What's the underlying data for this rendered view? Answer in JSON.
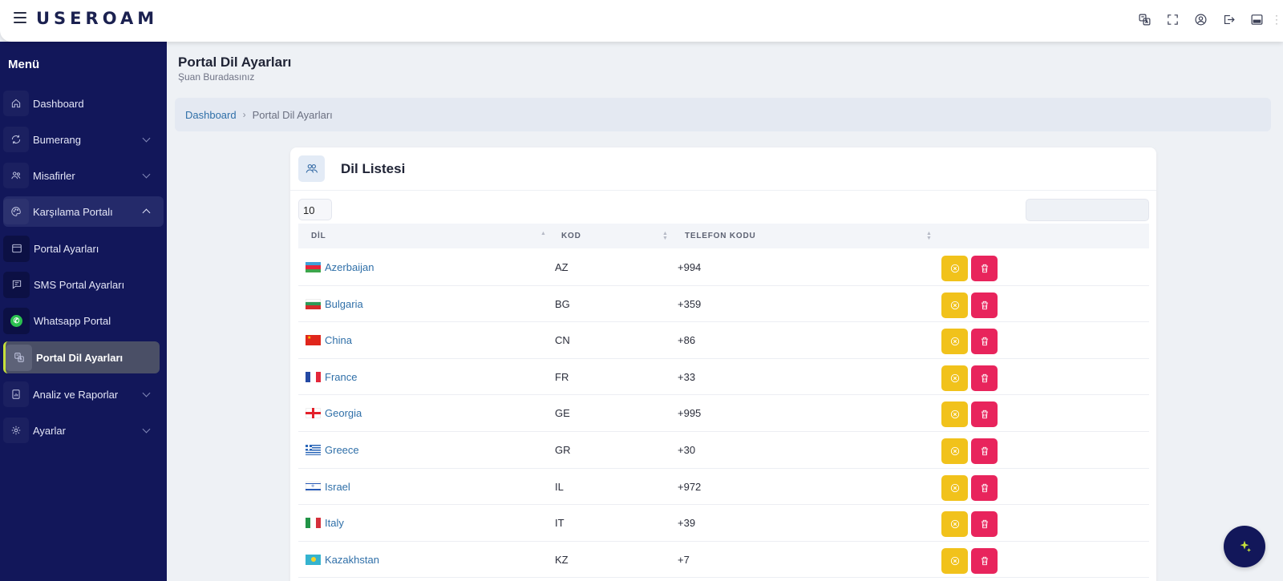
{
  "header": {
    "logo": "USEROAM",
    "icons": [
      "translate-icon",
      "fullscreen-icon",
      "user-icon",
      "logout-icon",
      "panel-icon"
    ]
  },
  "sidebar": {
    "title": "Menü",
    "items": [
      {
        "label": "Dashboard",
        "icon": "home-icon"
      },
      {
        "label": "Bumerang",
        "icon": "refresh-icon"
      },
      {
        "label": "Misafirler",
        "icon": "users-icon"
      },
      {
        "label": "Karşılama Portalı",
        "icon": "palette-icon"
      },
      {
        "label": "Portal Ayarları",
        "icon": "window-icon"
      },
      {
        "label": "SMS Portal Ayarları",
        "icon": "message-icon"
      },
      {
        "label": "Whatsapp Portal",
        "icon": "whatsapp-icon"
      },
      {
        "label": "Portal Dil Ayarları",
        "icon": "language-icon"
      },
      {
        "label": "Analiz ve Raporlar",
        "icon": "report-icon"
      },
      {
        "label": "Ayarlar",
        "icon": "settings-icon"
      }
    ]
  },
  "page": {
    "title": "Portal Dil Ayarları",
    "subtitle": "Şuan Buradasınız"
  },
  "breadcrumb": {
    "home": "Dashboard",
    "separator": "›",
    "current": "Portal Dil Ayarları"
  },
  "card": {
    "title": "Dil Listesi",
    "page_length": "10",
    "search_value": ""
  },
  "table": {
    "columns": [
      "DİL",
      "KOD",
      "TELEFON KODU"
    ],
    "rows": [
      {
        "lang": "Azerbaijan",
        "code": "AZ",
        "phone": "+994"
      },
      {
        "lang": "Bulgaria",
        "code": "BG",
        "phone": "+359"
      },
      {
        "lang": "China",
        "code": "CN",
        "phone": "+86"
      },
      {
        "lang": "France",
        "code": "FR",
        "phone": "+33"
      },
      {
        "lang": "Georgia",
        "code": "GE",
        "phone": "+995"
      },
      {
        "lang": "Greece",
        "code": "GR",
        "phone": "+30"
      },
      {
        "lang": "Israel",
        "code": "IL",
        "phone": "+972"
      },
      {
        "lang": "Italy",
        "code": "IT",
        "phone": "+39"
      },
      {
        "lang": "Kazakhstan",
        "code": "KZ",
        "phone": "+7"
      }
    ]
  },
  "colors": {
    "sidebar": "#12175a",
    "link": "#2f6fa8",
    "warn_button": "#f1c21b",
    "delete_button": "#e8245c"
  }
}
